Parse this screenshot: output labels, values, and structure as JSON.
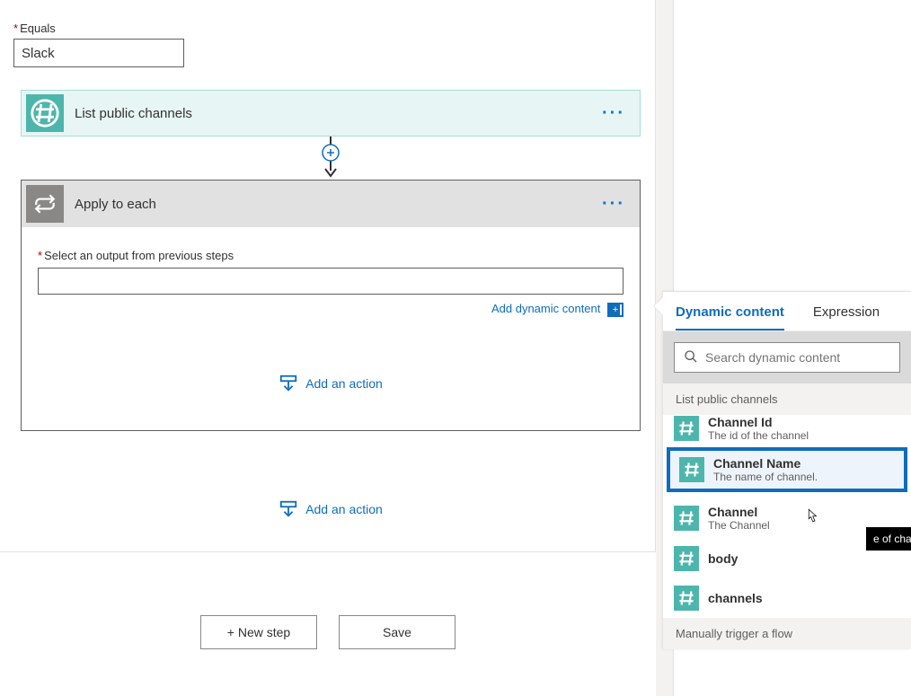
{
  "equals": {
    "label": "Equals",
    "value": "Slack"
  },
  "cards": {
    "listChannels": {
      "title": "List public channels"
    },
    "applyEach": {
      "title": "Apply to each",
      "selectLabel": "Select an output from previous steps",
      "addDynamic": "Add dynamic content",
      "addAction": "Add an action"
    }
  },
  "outerAddAction": "Add an action",
  "footer": {
    "newStep": "+ New step",
    "save": "Save"
  },
  "dynamicPanel": {
    "tabs": {
      "dynamic": "Dynamic content",
      "expression": "Expression"
    },
    "searchPlaceholder": "Search dynamic content",
    "sections": [
      {
        "title": "List public channels",
        "items": [
          {
            "title": "Channel Id",
            "desc": "The id of the channel"
          },
          {
            "title": "Channel Name",
            "desc": "The name of channel.",
            "highlighted": true
          },
          {
            "title": "Channel",
            "desc": "The Channel"
          },
          {
            "title": "body",
            "desc": ""
          },
          {
            "title": "channels",
            "desc": ""
          }
        ]
      },
      {
        "title": "Manually trigger a flow",
        "items": []
      }
    ],
    "tooltipFragment": "e of cha"
  },
  "icons": {
    "hash": "hash-icon",
    "loop": "loop-icon",
    "search": "search-icon",
    "addAction": "add-action-icon"
  },
  "chart_data": null
}
